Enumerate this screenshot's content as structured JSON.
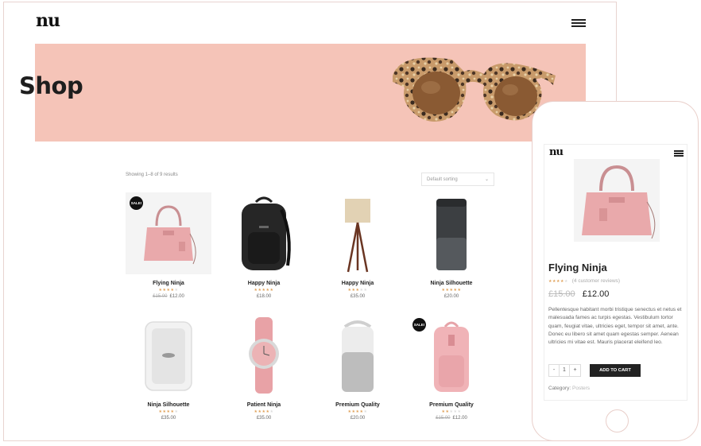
{
  "desktop": {
    "logo": "nu",
    "hero_title": "Shop",
    "result_count": "Showing 1–8 of 9 results",
    "sort": {
      "selected": "Default sorting"
    },
    "products": [
      {
        "name": "Flying Ninja",
        "sale": "SALE!",
        "old_price": "£15.00",
        "price": "£12.00",
        "rating": 4
      },
      {
        "name": "Happy Ninja",
        "sale": "",
        "old_price": "",
        "price": "£18.00",
        "rating": 5
      },
      {
        "name": "Happy Ninja",
        "sale": "",
        "old_price": "",
        "price": "£35.00",
        "rating": 3
      },
      {
        "name": "Ninja Silhouette",
        "sale": "",
        "old_price": "",
        "price": "£20.00",
        "rating": 5
      },
      {
        "name": "Ninja Silhouette",
        "sale": "",
        "old_price": "",
        "price": "£35.00",
        "rating": 4
      },
      {
        "name": "Patient Ninja",
        "sale": "",
        "old_price": "",
        "price": "£35.00",
        "rating": 4
      },
      {
        "name": "Premium Quality",
        "sale": "",
        "old_price": "",
        "price": "£20.00",
        "rating": 4
      },
      {
        "name": "Premium Quality",
        "sale": "SALE!",
        "old_price": "£15.00",
        "price": "£12.00",
        "rating": 2
      }
    ]
  },
  "mobile": {
    "logo": "nu",
    "title": "Flying Ninja",
    "rating": 4,
    "reviews": "(4 customer reviews)",
    "old_price": "£15.00",
    "price": "£12.00",
    "description": "Pellentesque habitant morbi tristique senectus et netus et malesuada fames ac turpis egestas. Vestibulum tortor quam, feugiat vitae, ultricies eget, tempor sit amet, ante. Donec eu libero sit amet quam egestas semper. Aenean ultricies mi vitae est. Mauris placerat eleifend leo.",
    "qty_minus": "-",
    "qty_value": "1",
    "qty_plus": "+",
    "add_to_cart": "ADD TO CART",
    "category_label": "Category:",
    "category_value": "Posters"
  },
  "colors": {
    "hero_bg": "#f5c4b8",
    "star": "#e0a25a",
    "accent_dark": "#222222",
    "frame": "#e8d4d0"
  }
}
